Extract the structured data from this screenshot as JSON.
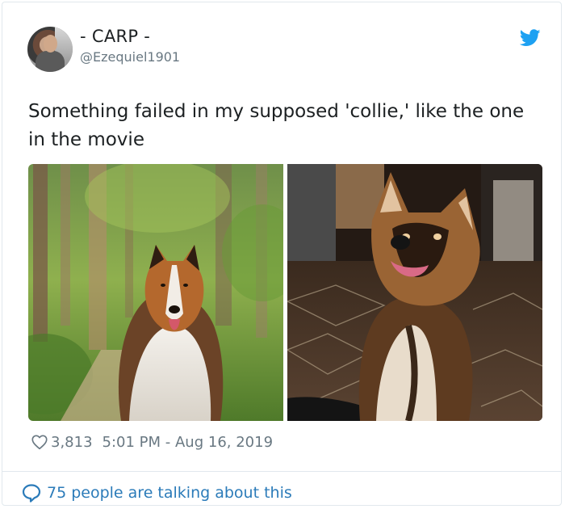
{
  "user": {
    "display_name": "- CARP -",
    "handle": "@Ezequiel1901",
    "avatar_icon": "avatar-photo"
  },
  "brand": {
    "icon": "twitter-bird-icon",
    "color": "#1da1f2"
  },
  "tweet": {
    "text": "Something failed in my supposed 'collie,' like the one in the movie"
  },
  "media": [
    {
      "name": "photo-rough-collie-in-forest"
    },
    {
      "name": "photo-german-shepherd-mix-indoors"
    }
  ],
  "stats": {
    "likes_icon": "heart-icon",
    "likes": "3,813",
    "timestamp": "5:01 PM - Aug 16, 2019"
  },
  "footer": {
    "icon": "speech-bubble-icon",
    "talking_text": "75 people are talking about this",
    "link_color": "#2b7bb9"
  }
}
